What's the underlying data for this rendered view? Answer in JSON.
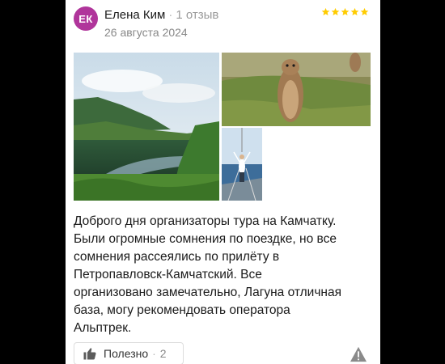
{
  "review": {
    "avatar_initials": "ЕК",
    "avatar_color": "#b0359b",
    "author_name": "Елена Ким",
    "review_count": "1 отзыв",
    "date": "26 августа 2024",
    "rating": 5,
    "star_color": "#ffcc00",
    "text_lines": [
      "Доброго дня организаторы тура на Камчатку.",
      "Были огромные сомнения по поездке, но все",
      "сомнения рассеялись по прилёту в",
      "Петропавловск-Камчатский. Все",
      "организовано замечательно, Лагуна отличная",
      "база, могу рекомендовать оператора",
      "Альптрек."
    ]
  },
  "actions": {
    "helpful_label": "Полезно",
    "helpful_count": "2"
  },
  "icons": [
    "thumbs-up-icon",
    "warning-icon",
    "star-icon"
  ]
}
